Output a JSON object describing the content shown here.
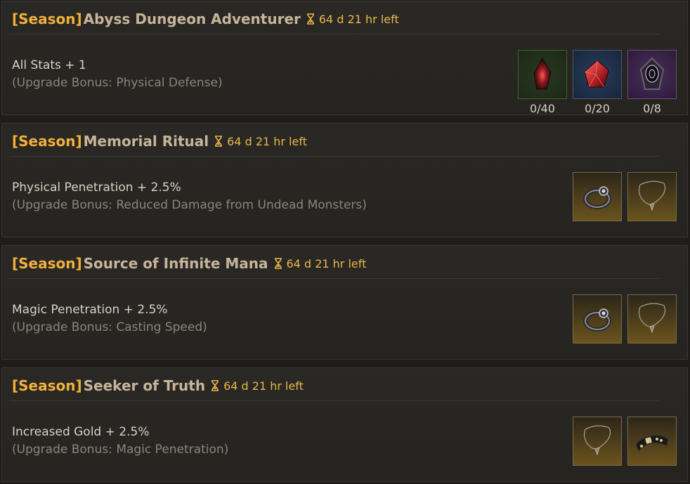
{
  "cards": [
    {
      "season_tag": "[Season]",
      "title": "Abyss Dungeon Adventurer",
      "timer": "64 d 21 hr  left",
      "stat": "All Stats + 1",
      "bonus": "(Upgrade Bonus: Physical Defense)",
      "items": [
        {
          "icon": "red-crystal-shard-icon",
          "frame": "green",
          "count": "0/40"
        },
        {
          "icon": "red-gem-icon",
          "frame": "blue",
          "count": "0/20"
        },
        {
          "icon": "dark-orb-icon",
          "frame": "purple",
          "count": "0/8"
        }
      ]
    },
    {
      "season_tag": "[Season]",
      "title": "Memorial Ritual",
      "timer": "64 d 21 hr  left",
      "stat": "Physical Penetration + 2.5%",
      "bonus": "(Upgrade Bonus: Reduced Damage from Undead Monsters)",
      "items": [
        {
          "icon": "ring-icon",
          "frame": "gold"
        },
        {
          "icon": "necklace-icon",
          "frame": "gold"
        }
      ]
    },
    {
      "season_tag": "[Season]",
      "title": "Source of Infinite Mana",
      "timer": "64 d 21 hr  left",
      "stat": "Magic Penetration + 2.5%",
      "bonus": "(Upgrade Bonus: Casting Speed)",
      "items": [
        {
          "icon": "ring-icon",
          "frame": "gold"
        },
        {
          "icon": "necklace-icon",
          "frame": "gold"
        }
      ]
    },
    {
      "season_tag": "[Season]",
      "title": "Seeker of Truth",
      "timer": "64 d 21 hr  left",
      "stat": "Increased Gold + 2.5%",
      "bonus": "(Upgrade Bonus: Magic Penetration)",
      "items": [
        {
          "icon": "necklace-icon",
          "frame": "gold"
        },
        {
          "icon": "belt-icon",
          "frame": "gold"
        }
      ]
    }
  ],
  "colors": {
    "season_tag": "#f2b13b",
    "title": "#c7b59a",
    "timer": "#e8b74a",
    "bonus_text": "#8a857c"
  }
}
